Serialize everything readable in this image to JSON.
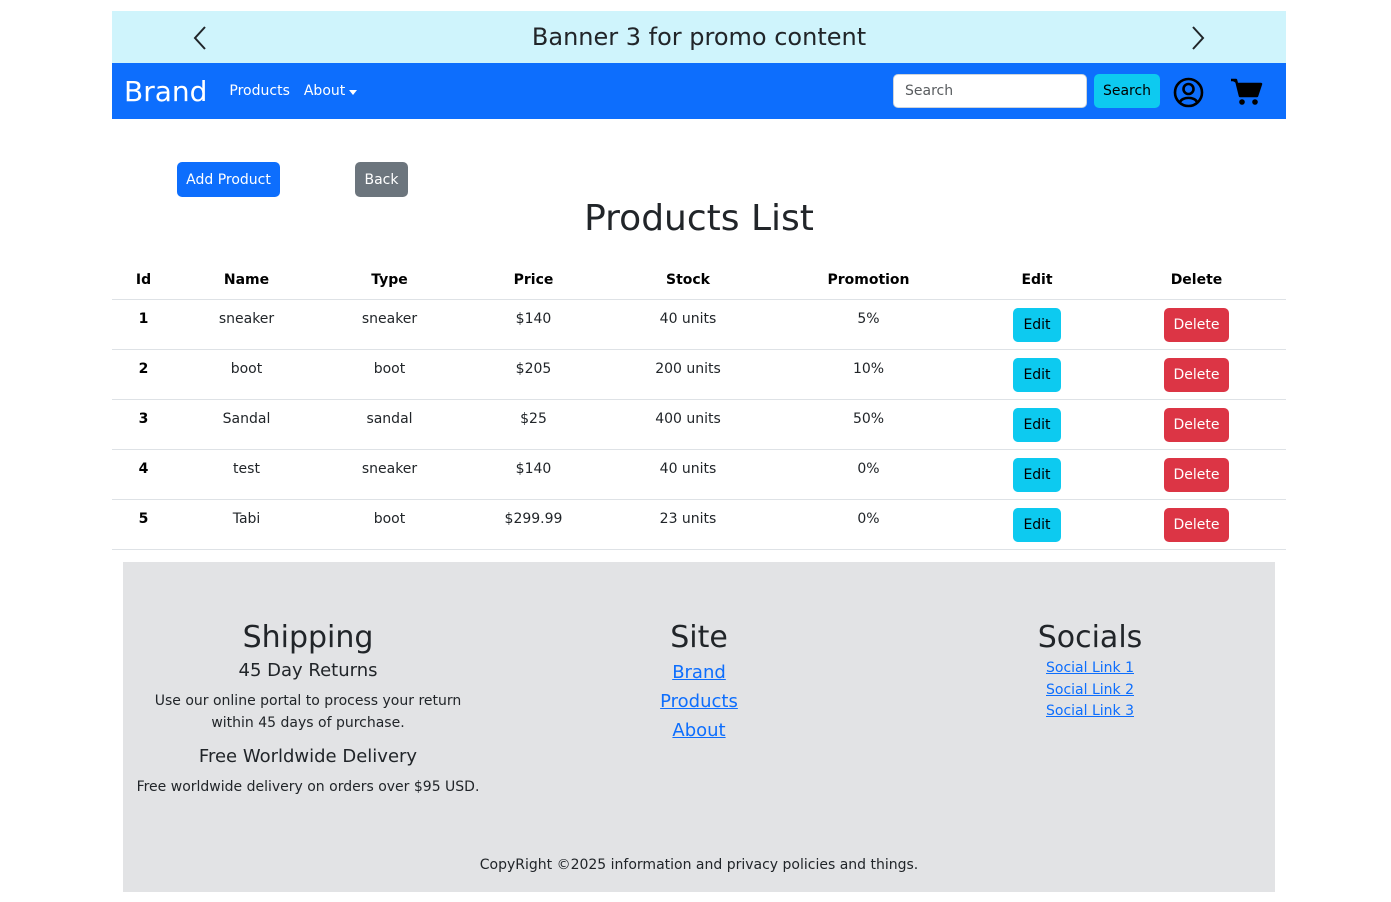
{
  "banner": {
    "title": "Banner 3 for promo content",
    "prev_icon": "chevron-left-icon",
    "next_icon": "chevron-right-icon"
  },
  "navbar": {
    "brand": "Brand",
    "links": [
      "Products",
      "About"
    ],
    "search_placeholder": "Search",
    "search_button": "Search",
    "user_icon": "user-circle-icon",
    "cart_icon": "cart-icon",
    "bg_color": "#0d6efd"
  },
  "actions": {
    "add_product": "Add Product",
    "back": "Back"
  },
  "page_title": "Products List",
  "table": {
    "headers": [
      "Id",
      "Name",
      "Type",
      "Price",
      "Stock",
      "Promotion",
      "Edit",
      "Delete"
    ],
    "rows": [
      {
        "id": "1",
        "name": "sneaker",
        "type": "sneaker",
        "price": "$140",
        "stock": "40 units",
        "promotion": "5%"
      },
      {
        "id": "2",
        "name": "boot",
        "type": "boot",
        "price": "$205",
        "stock": "200 units",
        "promotion": "10%"
      },
      {
        "id": "3",
        "name": "Sandal",
        "type": "sandal",
        "price": "$25",
        "stock": "400 units",
        "promotion": "50%"
      },
      {
        "id": "4",
        "name": "test",
        "type": "sneaker",
        "price": "$140",
        "stock": "40 units",
        "promotion": "0%"
      },
      {
        "id": "5",
        "name": "Tabi",
        "type": "boot",
        "price": "$299.99",
        "stock": "23 units",
        "promotion": "0%"
      }
    ],
    "edit_label": "Edit",
    "delete_label": "Delete"
  },
  "footer": {
    "shipping": {
      "title": "Shipping",
      "returns_title": "45 Day Returns",
      "returns_text": "Use our online portal to process your return within 45 days of purchase.",
      "delivery_title": "Free Worldwide Delivery",
      "delivery_text": "Free worldwide delivery on orders over $95 USD."
    },
    "site": {
      "title": "Site",
      "links": [
        "Brand",
        "Products",
        "About"
      ]
    },
    "socials": {
      "title": "Socials",
      "links": [
        "Social Link 1",
        "Social Link 2",
        "Social Link 3"
      ]
    },
    "copyright": "CopyRight ©2025 information and privacy policies and things."
  }
}
